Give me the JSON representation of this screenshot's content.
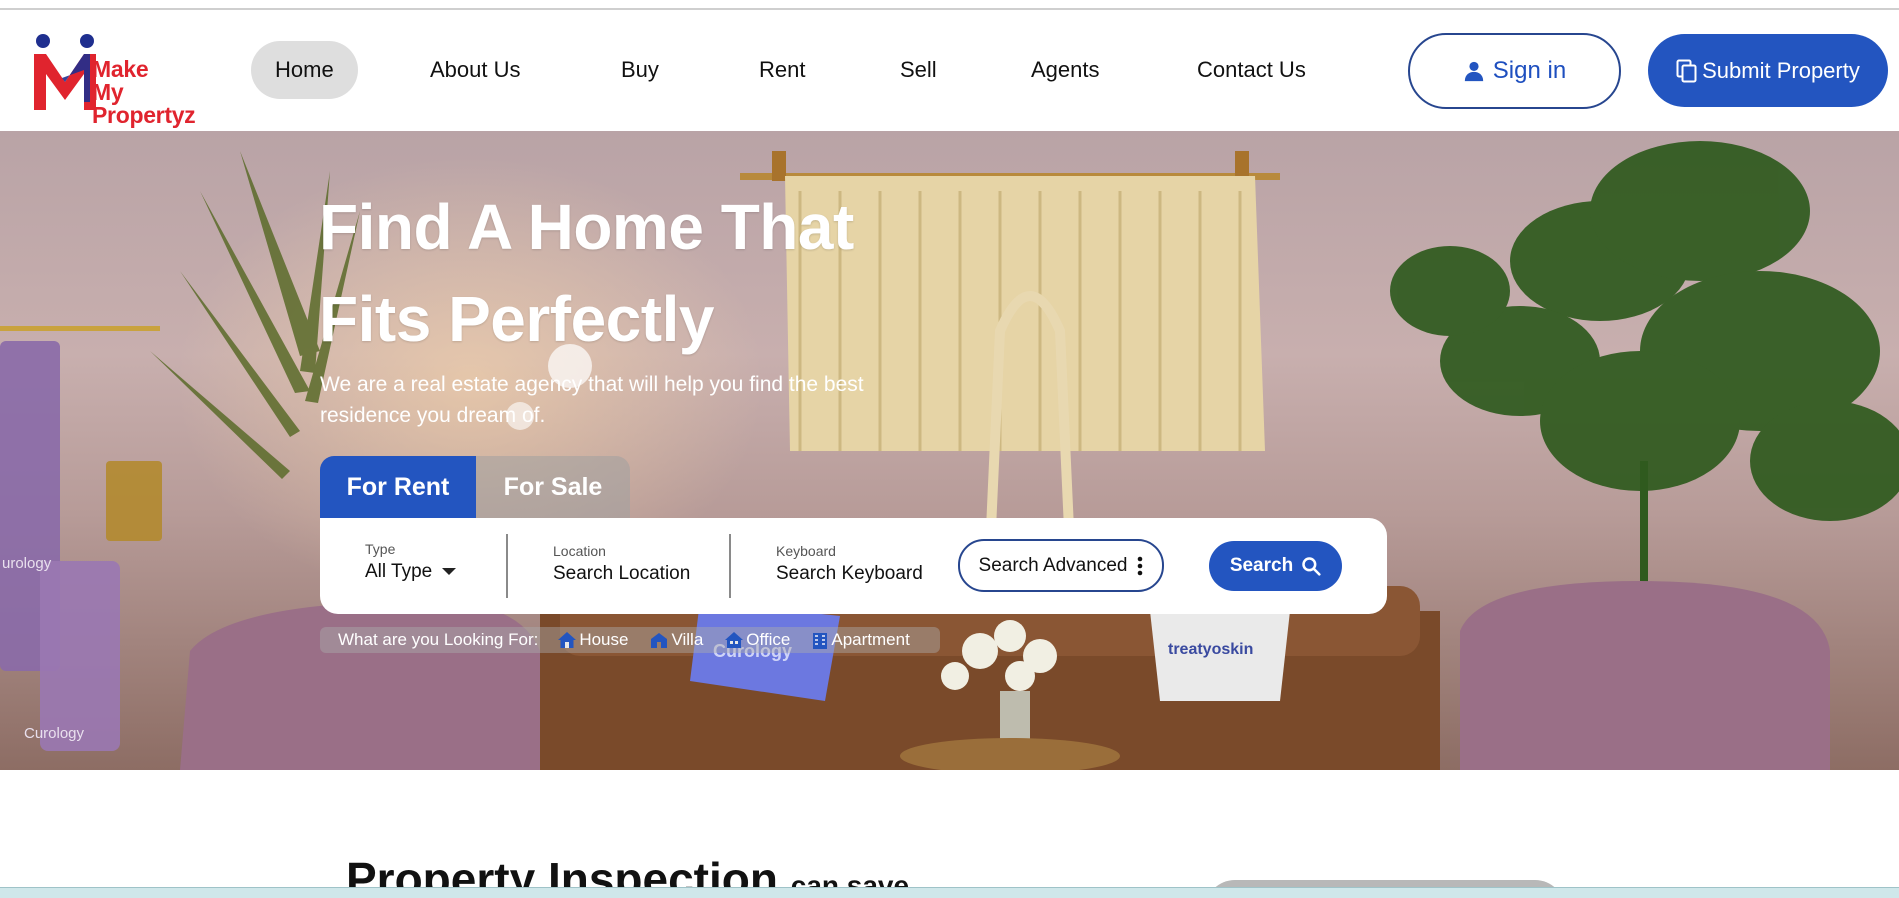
{
  "brand": {
    "line1": "Make",
    "line2": "My Propertyz",
    "colors": {
      "red": "#e0242e",
      "blue": "#1f2f8f"
    }
  },
  "nav": {
    "items": [
      {
        "label": "Home",
        "active": true
      },
      {
        "label": "About Us"
      },
      {
        "label": "Buy"
      },
      {
        "label": "Rent"
      },
      {
        "label": "Sell"
      },
      {
        "label": "Agents"
      },
      {
        "label": "Contact Us"
      }
    ]
  },
  "header_actions": {
    "signin_label": "Sign in",
    "submit_label": "Submit Property",
    "accent": "#2355c0"
  },
  "hero": {
    "title_line1": "Find A Home That",
    "title_line2": "Fits Perfectly",
    "subtitle_line1": "We are a real estate agency that will help you find the best",
    "subtitle_line2": "residence you dream of.",
    "background_prints": {
      "pillow": "Curology",
      "towel1": "urology",
      "towel2": "Curology",
      "pillow2": "treatyoskin"
    }
  },
  "tabs": [
    {
      "label": "For Rent",
      "active": true
    },
    {
      "label": "For Sale",
      "active": false
    }
  ],
  "search": {
    "type_label": "Type",
    "type_value": "All Type",
    "location_label": "Location",
    "location_value": "Search Location",
    "keyboard_label": "Keyboard",
    "keyboard_value": "Search Keyboard",
    "advanced_label": "Search Advanced",
    "search_label": "Search"
  },
  "looking_for": {
    "label": "What are you Looking For:",
    "items": [
      {
        "label": "House",
        "icon": "house-icon"
      },
      {
        "label": "Villa",
        "icon": "villa-icon"
      },
      {
        "label": "Office",
        "icon": "office-icon"
      },
      {
        "label": "Apartment",
        "icon": "apartment-icon"
      }
    ]
  },
  "section": {
    "title": "Property Inspection",
    "title_suffix": "can save"
  }
}
